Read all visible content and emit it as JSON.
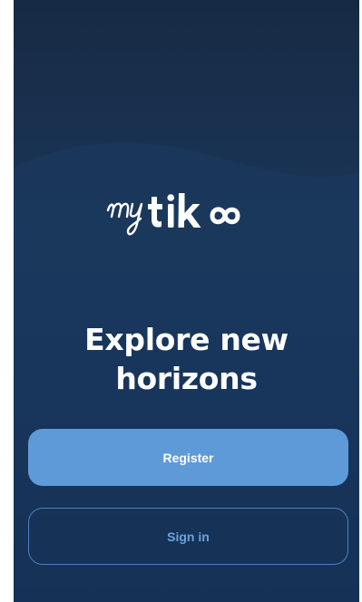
{
  "brand": {
    "logo_text": "mytikee",
    "colors": {
      "background_top": "#172a44",
      "background_bottom": "#0f2748",
      "primary_button": "#5f9ad8",
      "outline_button_border": "#4e7fbf",
      "outline_button_text": "#6aa3e0"
    }
  },
  "welcome": {
    "headline_line1": "Explore new",
    "headline_line2": "horizons"
  },
  "actions": {
    "register_label": "Register",
    "signin_label": "Sign in"
  }
}
